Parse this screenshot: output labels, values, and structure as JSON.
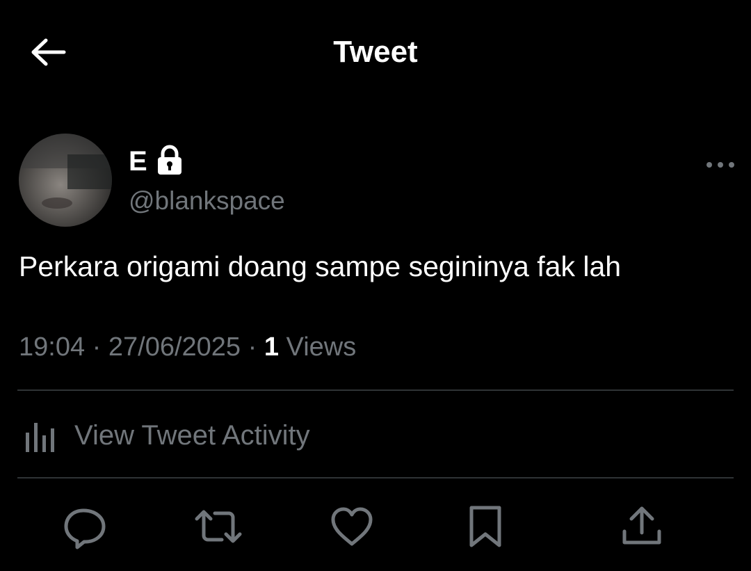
{
  "header": {
    "title": "Tweet",
    "back_icon": "arrow-left-icon"
  },
  "tweet": {
    "author": {
      "display_name": "E",
      "handle": "@blankspace",
      "protected_icon": "lock-icon"
    },
    "text": "Perkara origami doang sampe segininya fak lah",
    "time": "19:04",
    "date": "27/06/2025",
    "separator": "·",
    "views_count": "1",
    "views_label": "Views",
    "more_icon": "more-horizontal-icon"
  },
  "activity": {
    "label": "View Tweet Activity",
    "icon": "bar-chart-icon"
  },
  "actions": [
    {
      "name": "reply",
      "icon": "reply-icon"
    },
    {
      "name": "retweet",
      "icon": "retweet-icon"
    },
    {
      "name": "like",
      "icon": "heart-icon"
    },
    {
      "name": "bookmark",
      "icon": "bookmark-icon"
    },
    {
      "name": "share",
      "icon": "share-icon"
    }
  ],
  "colors": {
    "background": "#000000",
    "primary_text": "#ffffff",
    "secondary_text": "#71767b",
    "divider": "#2f3336"
  }
}
